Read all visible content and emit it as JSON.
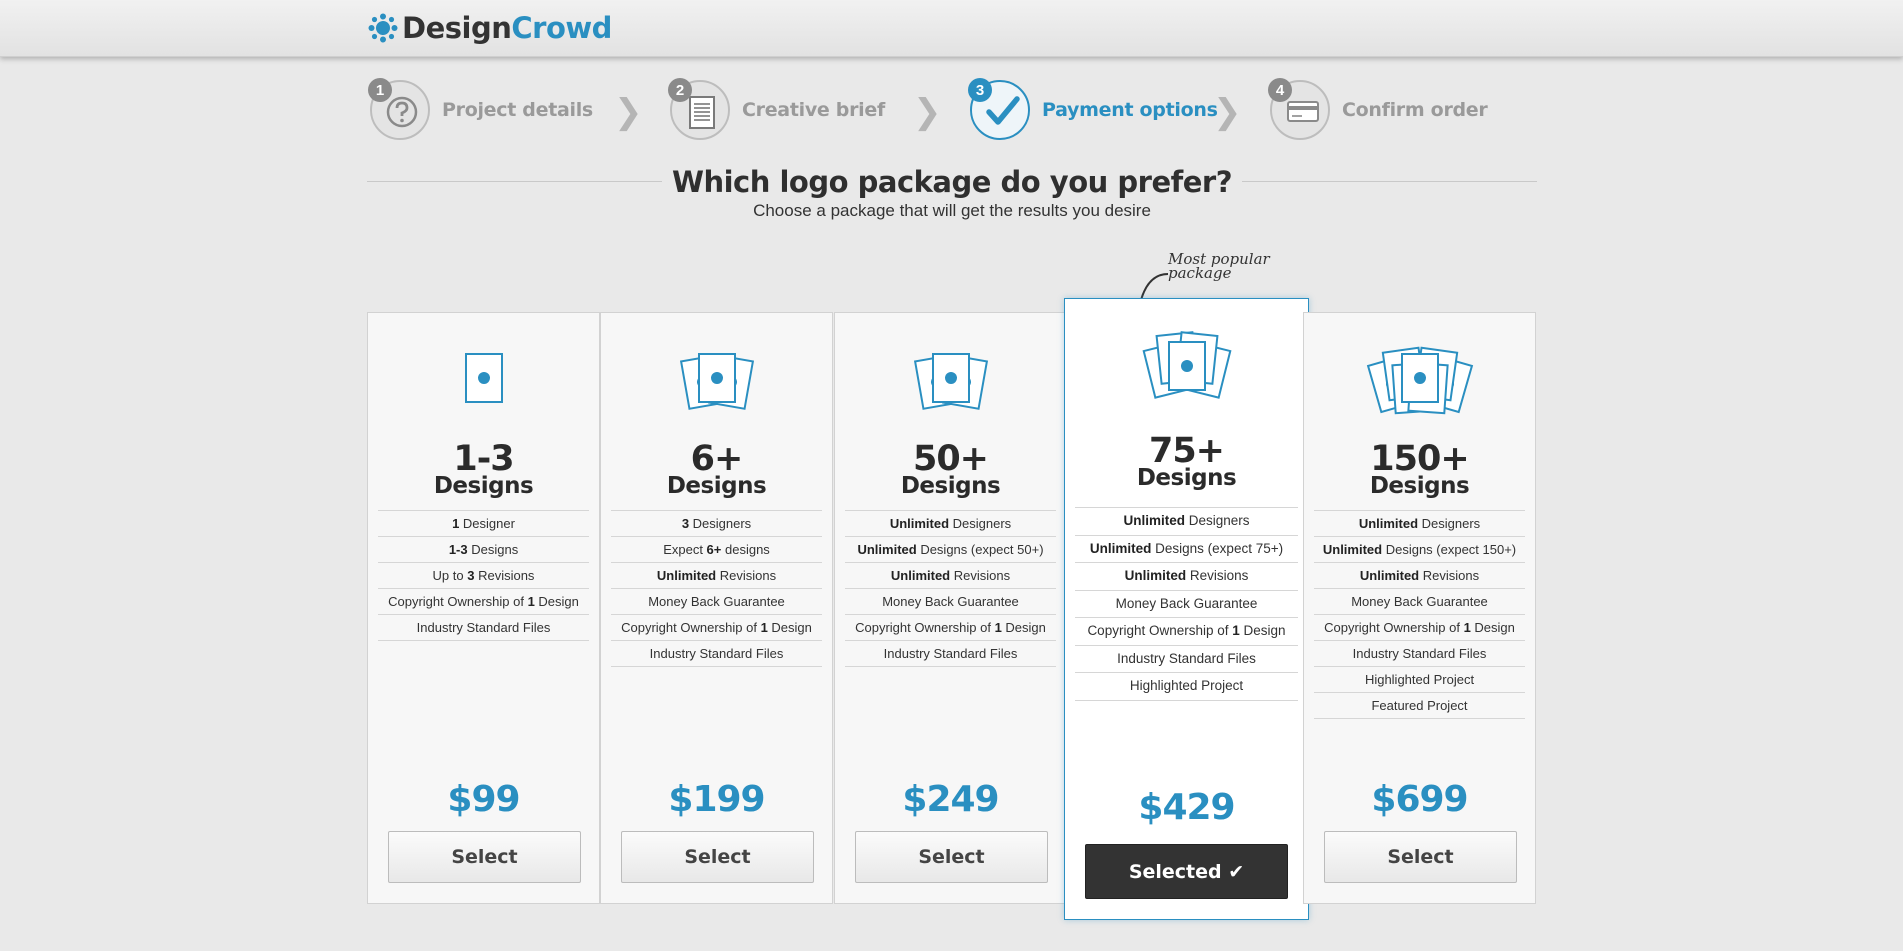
{
  "brand": {
    "part1": "Design",
    "part2": "Crowd",
    "icon": "design-crowd-logo-icon"
  },
  "steps": [
    {
      "num": "1",
      "label": "Project details",
      "icon": "question-icon",
      "active": false
    },
    {
      "num": "2",
      "label": "Creative brief",
      "icon": "document-icon",
      "active": false
    },
    {
      "num": "3",
      "label": "Payment options",
      "icon": "checkmark-icon",
      "active": true
    },
    {
      "num": "4",
      "label": "Confirm order",
      "icon": "credit-card-icon",
      "active": false
    }
  ],
  "page": {
    "title": "Which logo package do you prefer?",
    "subtitle": "Choose a package that will get the results you desire",
    "popular_note_line1": "Most popular",
    "popular_note_line2": "package"
  },
  "packages": [
    {
      "qty": "1-3",
      "unit": "Designs",
      "price": "$99",
      "button": "Select",
      "selected": false,
      "features": [
        {
          "bold": "1",
          "text": " Designer"
        },
        {
          "bold": "1-3",
          "text": " Designs"
        },
        {
          "pre": "Up to ",
          "bold": "3",
          "text": " Revisions"
        },
        {
          "pre": "Copyright Ownership of ",
          "bold": "1",
          "text": " Design"
        },
        {
          "text": "Industry Standard Files"
        }
      ]
    },
    {
      "qty": "6+",
      "unit": "Designs",
      "price": "$199",
      "button": "Select",
      "selected": false,
      "features": [
        {
          "bold": "3",
          "text": " Designers"
        },
        {
          "pre": "Expect ",
          "bold": "6+",
          "text": " designs"
        },
        {
          "bold": "Unlimited",
          "text": " Revisions"
        },
        {
          "text": "Money Back Guarantee"
        },
        {
          "pre": "Copyright Ownership of ",
          "bold": "1",
          "text": " Design"
        },
        {
          "text": "Industry Standard Files"
        }
      ]
    },
    {
      "qty": "50+",
      "unit": "Designs",
      "price": "$249",
      "button": "Select",
      "selected": false,
      "features": [
        {
          "bold": "Unlimited",
          "text": " Designers"
        },
        {
          "bold": "Unlimited",
          "text": " Designs (expect 50+)"
        },
        {
          "bold": "Unlimited",
          "text": " Revisions"
        },
        {
          "text": "Money Back Guarantee"
        },
        {
          "pre": "Copyright Ownership of ",
          "bold": "1",
          "text": " Design"
        },
        {
          "text": "Industry Standard Files"
        }
      ]
    },
    {
      "qty": "75+",
      "unit": "Designs",
      "price": "$429",
      "button": "Selected ✔",
      "selected": true,
      "features": [
        {
          "bold": "Unlimited",
          "text": " Designers"
        },
        {
          "bold": "Unlimited",
          "text": " Designs (expect 75+)"
        },
        {
          "bold": "Unlimited",
          "text": " Revisions"
        },
        {
          "text": "Money Back Guarantee"
        },
        {
          "pre": "Copyright Ownership of ",
          "bold": "1",
          "text": " Design"
        },
        {
          "text": "Industry Standard Files"
        },
        {
          "text": "Highlighted Project"
        }
      ]
    },
    {
      "qty": "150+",
      "unit": "Designs",
      "price": "$699",
      "button": "Select",
      "selected": false,
      "features": [
        {
          "bold": "Unlimited",
          "text": " Designers"
        },
        {
          "bold": "Unlimited",
          "text": " Designs (expect 150+)"
        },
        {
          "bold": "Unlimited",
          "text": " Revisions"
        },
        {
          "text": "Money Back Guarantee"
        },
        {
          "pre": "Copyright Ownership of ",
          "bold": "1",
          "text": " Design"
        },
        {
          "text": "Industry Standard Files"
        },
        {
          "text": "Highlighted Project"
        },
        {
          "text": "Featured Project"
        }
      ]
    }
  ],
  "colors": {
    "accent": "#2a8fc1",
    "dark": "#333333",
    "background": "#e9e9e9"
  }
}
